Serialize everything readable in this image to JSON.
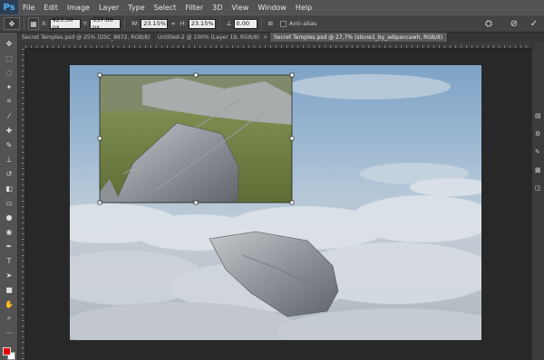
{
  "app": {
    "logo": "Ps"
  },
  "menu": [
    "File",
    "Edit",
    "Image",
    "Layer",
    "Type",
    "Select",
    "Filter",
    "3D",
    "View",
    "Window",
    "Help"
  ],
  "options": {
    "x_label": "X:",
    "x_value": "923.50 px",
    "y_label": "Y:",
    "y_value": "537.00 px",
    "w_label": "W:",
    "w_value": "23.15%",
    "h_label": "H:",
    "h_value": "23.15%",
    "angle_label": "∠",
    "angle_value": "0.00",
    "antialias_label": "Anti-alias"
  },
  "tabs": [
    {
      "label": "Secret Temples.psd @ 25% (DSC_8872, RGB/8)",
      "close": "×",
      "active": false
    },
    {
      "label": "Untitled-2 @ 100% (Layer 19, RGB/8)",
      "close": "×",
      "active": false
    },
    {
      "label": "Secret Temples.psd @ 27,7% (stone1_by_adipancawh, RGB/8)",
      "close": "×",
      "active": true
    }
  ],
  "icons": {
    "move": "move-tool-icon",
    "marquee": "marquee-tool-icon",
    "lasso": "lasso-tool-icon",
    "wand": "magic-wand-icon",
    "crop": "crop-tool-icon",
    "eyedropper": "eyedropper-icon",
    "heal": "healing-brush-icon",
    "brush": "brush-tool-icon",
    "stamp": "clone-stamp-icon",
    "history": "history-brush-icon",
    "eraser": "eraser-icon",
    "gradient": "gradient-tool-icon",
    "blur": "blur-tool-icon",
    "dodge": "dodge-tool-icon",
    "pen": "pen-tool-icon",
    "type": "type-tool-icon",
    "path": "path-select-icon",
    "shape": "rectangle-tool-icon",
    "hand": "hand-tool-icon",
    "zoom": "zoom-tool-icon"
  },
  "colors": {
    "foreground": "#e40000",
    "background": "#ffffff",
    "accent": "#4fb4ff"
  }
}
